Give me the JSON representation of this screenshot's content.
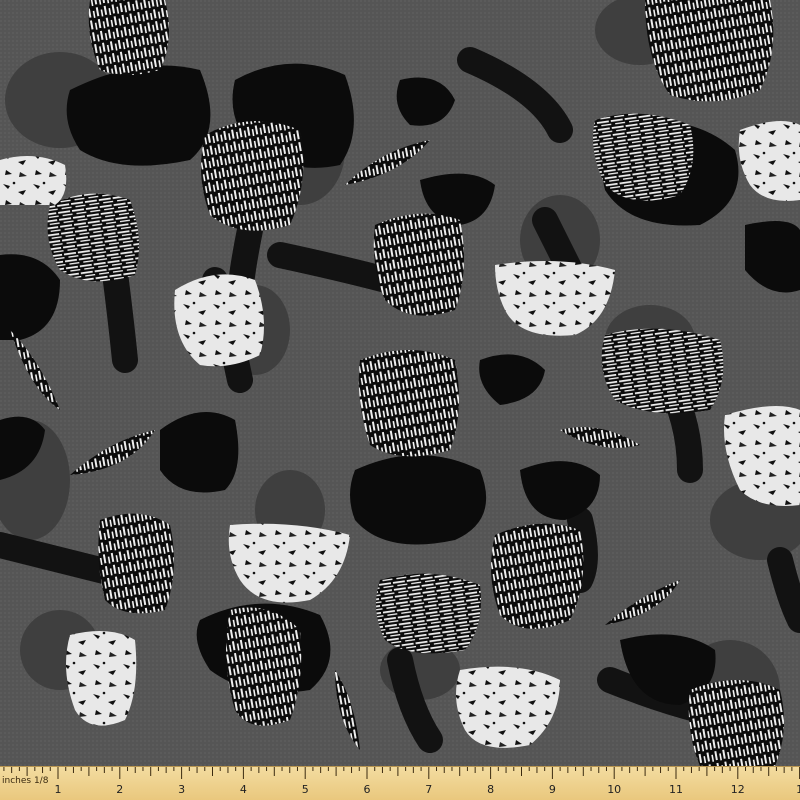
{
  "ruler": {
    "unit_label": "inches 1/8",
    "numbers": [
      "1",
      "2",
      "3",
      "4",
      "5",
      "6",
      "7",
      "8",
      "9",
      "10",
      "11",
      "12",
      "1"
    ]
  },
  "colors": {
    "background": "#565656",
    "dark_cap": "#0b0b0b",
    "stem": "#151515",
    "mid_shadow": "#3f3f3f",
    "light_cap": "#e6e6e6",
    "ruler": "#efd394"
  },
  "pattern": {
    "description_items": [
      {
        "kind": "striped-cap-icon"
      },
      {
        "kind": "speckled-cap-icon"
      },
      {
        "kind": "dark-cap-icon"
      },
      {
        "kind": "stem-icon"
      }
    ]
  }
}
